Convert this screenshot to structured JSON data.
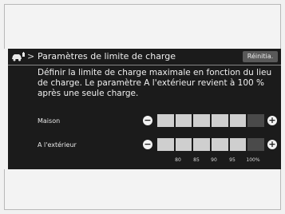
{
  "header": {
    "title": "Paramètres de limite de charge",
    "reset_label": "Réinitia."
  },
  "description": "Définir la limite de charge maximale en fonction du lieu de charge. Le paramètre A l'extérieur revient à 100 % après une seule charge.",
  "rows": [
    {
      "label": "Maison",
      "level_segments_on": 5,
      "total_segments": 6
    },
    {
      "label": "A l'extérieur",
      "level_segments_on": 5,
      "total_segments": 6
    }
  ],
  "scale_ticks": [
    "80",
    "85",
    "90",
    "95",
    "100%"
  ],
  "controls": {
    "decrease": "−",
    "increase": "+"
  },
  "icons": {
    "header": "car-charge-icon",
    "chevron": "chevron-right-icon"
  }
}
